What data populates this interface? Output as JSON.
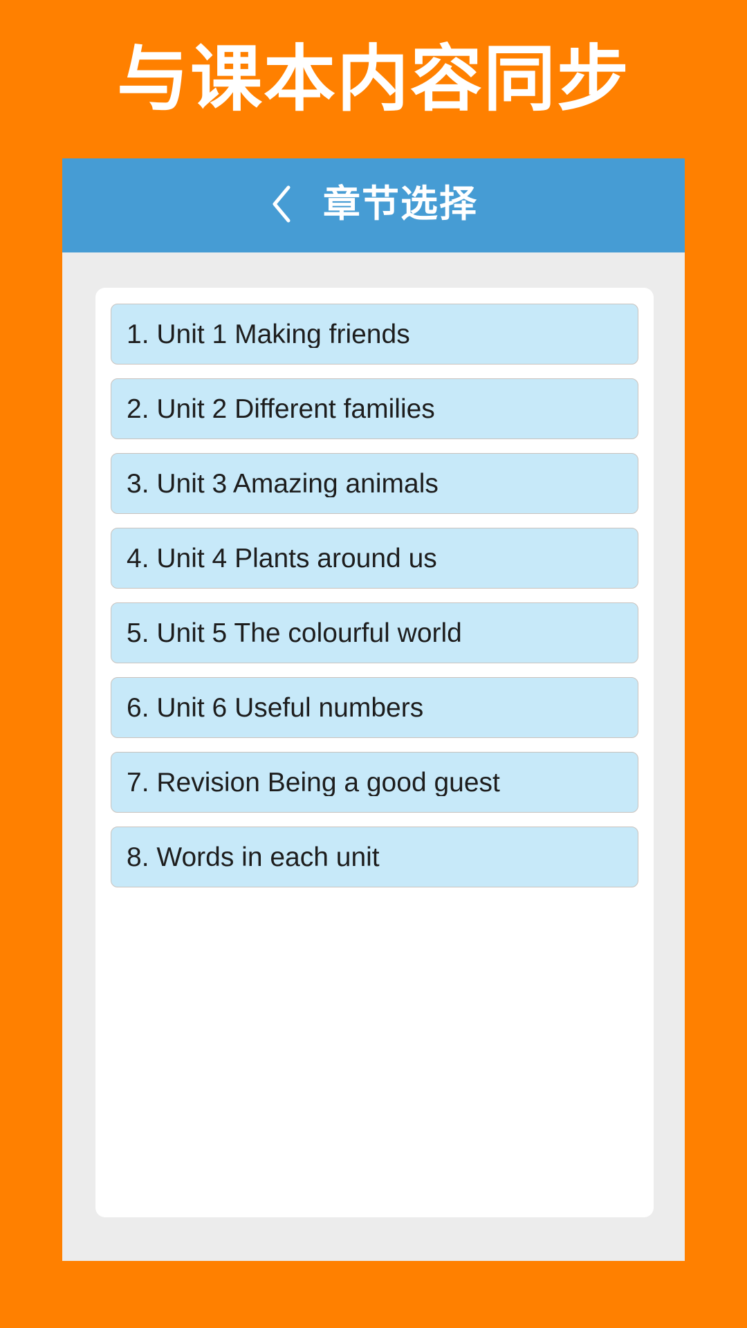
{
  "promo": {
    "headline": "与课本内容同步"
  },
  "app_bar": {
    "back_icon": "chevron-left-icon",
    "title": "章节选择"
  },
  "chapter_list": {
    "items": [
      {
        "label": "1. Unit 1 Making friends"
      },
      {
        "label": "2. Unit 2 Different families"
      },
      {
        "label": "3. Unit 3 Amazing animals"
      },
      {
        "label": "4. Unit 4 Plants around us"
      },
      {
        "label": "5. Unit 5 The colourful world"
      },
      {
        "label": "6. Unit 6 Useful numbers"
      },
      {
        "label": "7. Revision Being a good guest"
      },
      {
        "label": "8. Words in each unit"
      }
    ]
  },
  "colors": {
    "background_orange": "#ff8000",
    "app_bar_blue": "#469cd4",
    "panel_gray": "#ececec",
    "card_white": "#ffffff",
    "item_blue": "#c7e9f9",
    "item_border": "#c9c2bd",
    "text_dark": "#1d1d1d",
    "text_white": "#ffffff"
  }
}
